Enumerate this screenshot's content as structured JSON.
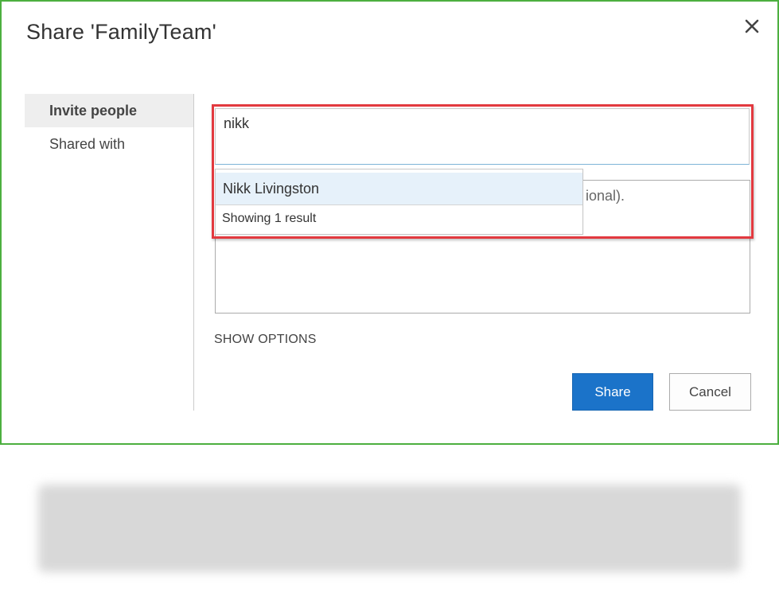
{
  "dialog": {
    "title": "Share 'FamilyTeam'",
    "close_icon": "close-icon",
    "border_color": "#4caf3f"
  },
  "nav": {
    "items": [
      {
        "label": "Invite people",
        "active": true
      },
      {
        "label": "Shared with",
        "active": false
      }
    ]
  },
  "invite": {
    "people_input_value": "nikk",
    "message_placeholder_visible": "ional).",
    "suggestions": [
      {
        "name": "Nikk Livingston"
      }
    ],
    "suggestion_count": "Showing 1 result",
    "highlight_color": "#e2393f"
  },
  "options": {
    "show_options_label": "SHOW OPTIONS"
  },
  "actions": {
    "share_label": "Share",
    "cancel_label": "Cancel",
    "share_color": "#1b73c9"
  }
}
